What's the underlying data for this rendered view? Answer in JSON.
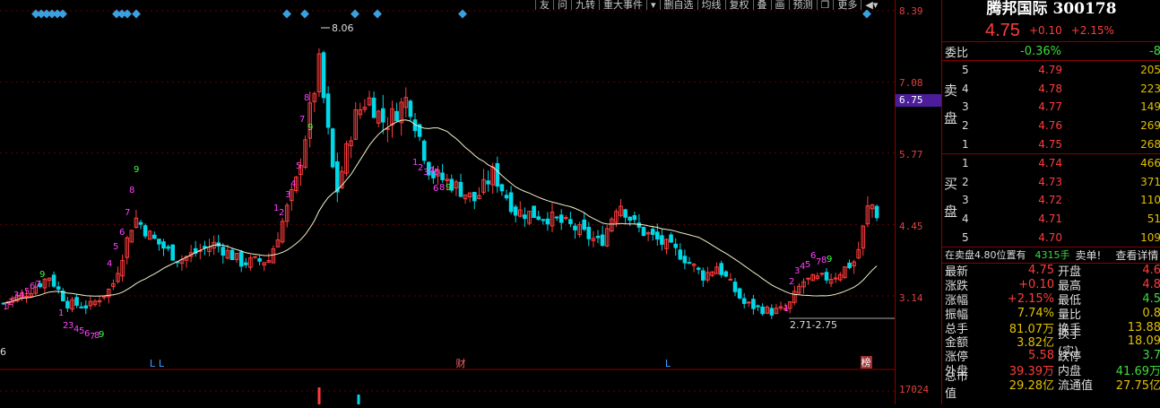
{
  "toolbar": {
    "items": [
      "友",
      "问",
      "九转",
      "重大事件",
      "",
      "删自选",
      "均线",
      "复权",
      "叠",
      "画",
      "预测",
      "",
      "更多",
      ""
    ]
  },
  "chart": {
    "high_label": "8.06",
    "low_label": "2.71-2.75",
    "left_value": "6",
    "event_markers": [
      "L",
      "L",
      "财",
      "L",
      "榜"
    ],
    "volume_value": "17024"
  },
  "price_axis": {
    "ticks": [
      "8.39",
      "7.08",
      "5.77",
      "4.45",
      "3.14"
    ],
    "highlight": "6.75"
  },
  "quote": {
    "title": "腾邦国际 300178",
    "last": "4.75",
    "change": "+0.10",
    "change_pct": "+2.15%",
    "weibi_label": "委比",
    "weibi_value": "-0.36%",
    "weibi_diff": "-8",
    "sell_label": "卖盘",
    "buy_label": "买盘",
    "sell_levels": [
      {
        "n": "5",
        "price": "4.79",
        "vol": "205"
      },
      {
        "n": "4",
        "price": "4.78",
        "vol": "223"
      },
      {
        "n": "3",
        "price": "4.77",
        "vol": "149"
      },
      {
        "n": "2",
        "price": "4.76",
        "vol": "269"
      },
      {
        "n": "1",
        "price": "4.75",
        "vol": "268"
      }
    ],
    "buy_levels": [
      {
        "n": "1",
        "price": "4.74",
        "vol": "466"
      },
      {
        "n": "2",
        "price": "4.73",
        "vol": "371"
      },
      {
        "n": "3",
        "price": "4.72",
        "vol": "110"
      },
      {
        "n": "4",
        "price": "4.71",
        "vol": "51"
      },
      {
        "n": "5",
        "price": "4.70",
        "vol": "109"
      }
    ],
    "notice_prefix": "在卖盘4.80位置有",
    "notice_amount": "4315手",
    "notice_type": "卖单!",
    "notice_link": "查看详情",
    "stats": [
      {
        "k": "最新",
        "v": "4.75",
        "vc": "red",
        "k2": "开盘",
        "v2": "4.6",
        "v2c": "red"
      },
      {
        "k": "涨跌",
        "v": "+0.10",
        "vc": "red",
        "k2": "最高",
        "v2": "4.8",
        "v2c": "red"
      },
      {
        "k": "涨幅",
        "v": "+2.15%",
        "vc": "red",
        "k2": "最低",
        "v2": "4.5",
        "v2c": "green"
      },
      {
        "k": "振幅",
        "v": "7.74%",
        "vc": "yellow",
        "k2": "量比",
        "v2": "0.8",
        "v2c": "yellow"
      },
      {
        "k": "总手",
        "v": "81.07万",
        "vc": "yellow",
        "k2": "换手",
        "v2": "13.88",
        "v2c": "yellow"
      },
      {
        "k": "金额",
        "v": "3.82亿",
        "vc": "yellow",
        "k2": "换手(实)",
        "v2": "18.09",
        "v2c": "yellow"
      },
      {
        "k": "涨停",
        "v": "5.58",
        "vc": "red",
        "k2": "跌停",
        "v2": "3.7",
        "v2c": "green"
      },
      {
        "k": "外盘",
        "v": "39.39万",
        "vc": "red",
        "k2": "内盘",
        "v2": "41.69万",
        "v2c": "green"
      },
      {
        "k": "总市值",
        "v": "29.28亿",
        "vc": "yellow",
        "k2": "流通值",
        "v2": "27.75亿",
        "v2c": "yellow"
      }
    ]
  },
  "colors": {
    "up": "#ff3c3c",
    "down": "#00d8e8",
    "ma": "#f0f0c8",
    "seq_magenta": "#ff40ff",
    "seq_green": "#40ff40",
    "marker": "#3aa0e0"
  }
}
